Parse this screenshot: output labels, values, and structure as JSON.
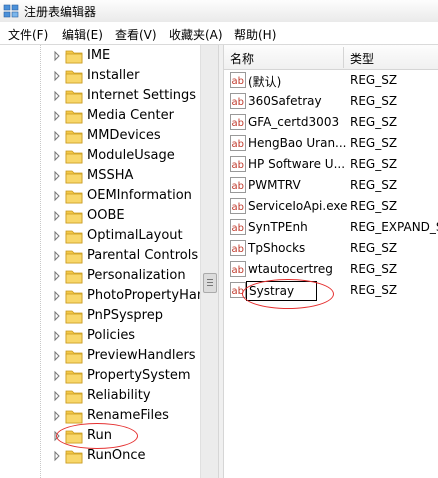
{
  "window": {
    "title": "注册表编辑器"
  },
  "menu": [
    {
      "label": "文件(F)"
    },
    {
      "label": "编辑(E)"
    },
    {
      "label": "查看(V)"
    },
    {
      "label": "收藏夹(A)"
    },
    {
      "label": "帮助(H)"
    }
  ],
  "tree": {
    "items": [
      {
        "label": "IME"
      },
      {
        "label": "Installer"
      },
      {
        "label": "Internet Settings"
      },
      {
        "label": "Media Center"
      },
      {
        "label": "MMDevices"
      },
      {
        "label": "ModuleUsage"
      },
      {
        "label": "MSSHA"
      },
      {
        "label": "OEMInformation"
      },
      {
        "label": "OOBE"
      },
      {
        "label": "OptimalLayout"
      },
      {
        "label": "Parental Controls"
      },
      {
        "label": "Personalization"
      },
      {
        "label": "PhotoPropertyHand"
      },
      {
        "label": "PnPSysprep"
      },
      {
        "label": "Policies"
      },
      {
        "label": "PreviewHandlers"
      },
      {
        "label": "PropertySystem"
      },
      {
        "label": "Reliability"
      },
      {
        "label": "RenameFiles"
      },
      {
        "label": "Run",
        "highlighted": true
      },
      {
        "label": "RunOnce"
      }
    ]
  },
  "values_list": {
    "columns": {
      "name": "名称",
      "type": "类型"
    },
    "rows": [
      {
        "name": "(默认)",
        "type": "REG_SZ"
      },
      {
        "name": "360Safetray",
        "type": "REG_SZ"
      },
      {
        "name": "GFA_certd3003",
        "type": "REG_SZ"
      },
      {
        "name": "HengBao Uran...",
        "type": "REG_SZ"
      },
      {
        "name": "HP Software U...",
        "type": "REG_SZ"
      },
      {
        "name": "PWMTRV",
        "type": "REG_SZ"
      },
      {
        "name": "ServiceIoApi.exe",
        "type": "REG_SZ"
      },
      {
        "name": "SynTPEnh",
        "type": "REG_EXPAND_S"
      },
      {
        "name": "TpShocks",
        "type": "REG_SZ"
      },
      {
        "name": "wtautocertreg",
        "type": "REG_SZ"
      }
    ],
    "editing_row": {
      "name": "Systray",
      "type": "REG_SZ"
    }
  },
  "colors": {
    "annotation": "#e53030",
    "folder": "#f3c84a",
    "ab_icon": "#c0392b"
  }
}
